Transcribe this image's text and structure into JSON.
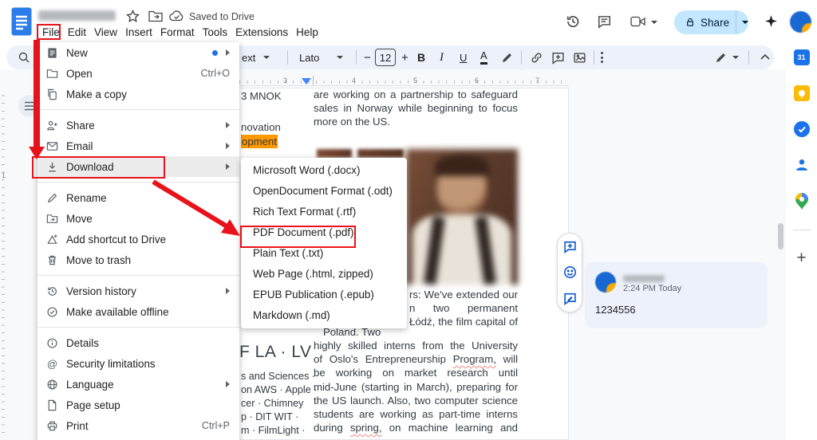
{
  "header": {
    "menubar": [
      "File",
      "Edit",
      "View",
      "Insert",
      "Format",
      "Tools",
      "Extensions",
      "Help"
    ],
    "saved_status": "Saved to Drive",
    "share_label": "Share",
    "action_icons": [
      "version-history-icon",
      "comments-icon",
      "meet-video-icon",
      "gemini-sparkle-icon",
      "account-avatar"
    ]
  },
  "toolbar": {
    "style_partial": "ext",
    "font_name": "Lato",
    "font_size": "12",
    "bold": "B",
    "italic": "I",
    "underline": "U",
    "text_color": "A"
  },
  "file_menu": {
    "items": [
      {
        "label": "New"
      },
      {
        "label": "Open",
        "shortcut": "Ctrl+O"
      },
      {
        "label": "Make a copy"
      },
      {
        "label": "Share"
      },
      {
        "label": "Email"
      },
      {
        "label": "Download"
      },
      {
        "label": "Rename"
      },
      {
        "label": "Move"
      },
      {
        "label": "Add shortcut to Drive"
      },
      {
        "label": "Move to trash"
      },
      {
        "label": "Version history"
      },
      {
        "label": "Make available offline"
      },
      {
        "label": "Details"
      },
      {
        "label": "Security limitations"
      },
      {
        "label": "Language"
      },
      {
        "label": "Page setup"
      },
      {
        "label": "Print",
        "shortcut": "Ctrl+P"
      }
    ]
  },
  "download_submenu": {
    "items": [
      {
        "label": "Microsoft Word (.docx)"
      },
      {
        "label": "OpenDocument Format (.odt)"
      },
      {
        "label": "Rich Text Format (.rtf)"
      },
      {
        "label": "PDF Document (.pdf)"
      },
      {
        "label": "Plain Text (.txt)"
      },
      {
        "label": "Web Page (.html, zipped)"
      },
      {
        "label": "EPUB Publication (.epub)"
      },
      {
        "label": "Markdown (.md)"
      }
    ]
  },
  "document": {
    "ruler_numbers": [
      "3",
      "4",
      "5",
      "6",
      "7"
    ],
    "vruler_number": "1",
    "left_col": {
      "frag1": "3 MNOK",
      "frag2": "novation",
      "frag3_highlighted": "opment",
      "heading": "F LA · LV",
      "list": [
        "s and Sciences ·",
        "on AWS · Apple ·",
        "cer · Chimney",
        "p · DIT WIT ·",
        "m · FilmLight ·"
      ]
    },
    "right_col": {
      "p1": [
        "are working on a partnership to safeguard",
        "sales in Norway while beginning to focus",
        "more on the US."
      ],
      "partial": [
        "rs: We've extended our",
        "n two permanent",
        "Łódź, the film capital of"
      ],
      "poland": "Poland. Two",
      "p2a": "highly skilled interns from the University",
      "p2b": {
        "pre": "of Oslo's Entrepreneurship ",
        "word": "Program,",
        "post": " will"
      },
      "p2c": "be working on market research until",
      "p2d": "mid-June (starting in March), preparing for",
      "p2e": "the US launch. Also, two computer science",
      "p2f": "students are working as part-time interns",
      "p2g": {
        "pre": "during ",
        "word": "spring,",
        "post": " on machine learning and"
      }
    }
  },
  "comment_card": {
    "time": "2:24 PM Today",
    "body": "1234556"
  },
  "side_rail": {
    "icons": [
      "calendar-icon",
      "keep-icon",
      "tasks-icon",
      "contacts-icon",
      "maps-icon",
      "add-addon-plus-icon"
    ],
    "calendar_day": "31"
  },
  "annotations": {
    "color": "#e8131a",
    "highlighted_path": [
      "File",
      "Download",
      "PDF Document (.pdf)"
    ]
  },
  "colors": {
    "annotation_red": "#e8131a",
    "text_highlight_orange": "#ff9900",
    "share_button_bg": "#c2e7ff",
    "accent_blue": "#1a73e8"
  }
}
